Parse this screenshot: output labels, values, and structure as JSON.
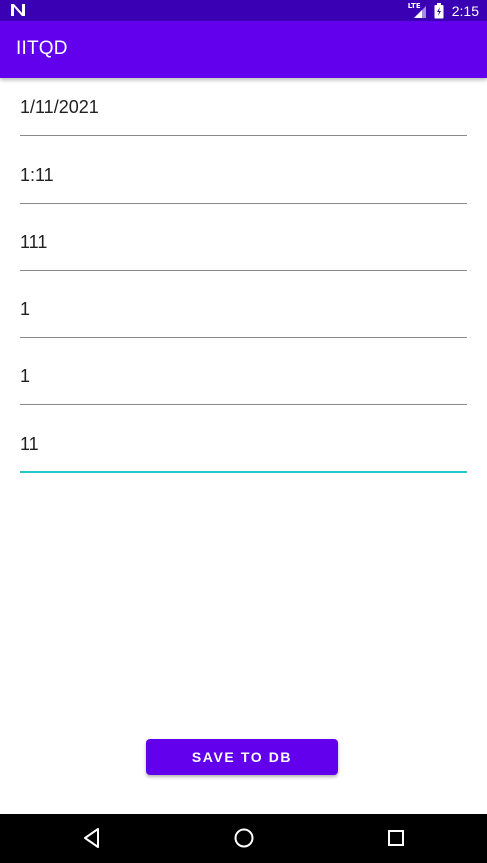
{
  "status_bar": {
    "network_label": "LTE",
    "time": "2:15",
    "icons": [
      "notification-n-icon",
      "signal-icon",
      "battery-icon"
    ]
  },
  "app_bar": {
    "title": "IITQD"
  },
  "form": {
    "fields": [
      {
        "value": "1/11/2021",
        "focused": false
      },
      {
        "value": "1:11",
        "focused": false
      },
      {
        "value": "111",
        "focused": false
      },
      {
        "value": "1",
        "focused": false
      },
      {
        "value": "1",
        "focused": false
      },
      {
        "value": "11",
        "focused": true
      }
    ]
  },
  "actions": {
    "save_label": "SAVE TO DB"
  },
  "nav_bar": {
    "icons": [
      "back-icon",
      "home-icon",
      "recents-icon"
    ]
  },
  "colors": {
    "status_bar": "#3a00b4",
    "primary": "#6200ee",
    "accent": "#26c6c6",
    "underline": "#8a8a8a"
  }
}
